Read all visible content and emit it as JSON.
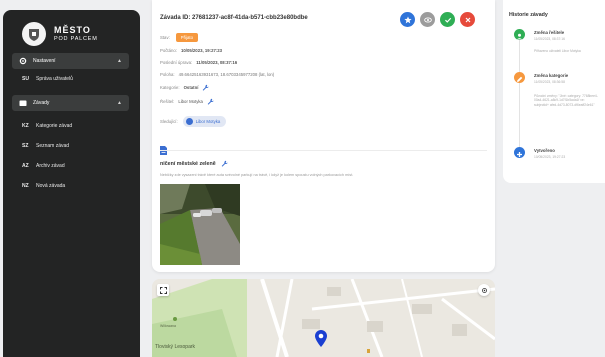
{
  "brand": {
    "line1": "MĚSTO",
    "line2": "POD PALCEM"
  },
  "sidebar": {
    "sections": [
      {
        "label": "Nastavení",
        "items": [
          {
            "code": "SU",
            "label": "Správa uživatelů"
          }
        ]
      },
      {
        "label": "Závady",
        "items": [
          {
            "code": "KZ",
            "label": "Kategorie závad"
          },
          {
            "code": "SZ",
            "label": "Seznam závad"
          },
          {
            "code": "AZ",
            "label": "Archiv závad"
          },
          {
            "code": "NZ",
            "label": "Nová závada"
          }
        ]
      }
    ]
  },
  "defect": {
    "title": "Závada ID: 27681237-ac8f-41da-b571-cbb23e80bdbe",
    "state_label": "Stav:",
    "state_value": "Přijato",
    "reported_label": "Počtáno:",
    "reported_value": "10/05/2023, 19:27:23",
    "last_change_label": "Poslední úprava:",
    "last_change_value": "11/05/2023, 08:37:16",
    "position_label": "Poloha:",
    "position_value": "49.66425163931673, 18.6703345977208 (lat, lon)",
    "category_label": "Kategorie:",
    "category_value": "Ostatní",
    "solver_label": "Řešitel:",
    "solver_value": "Libor Motyka",
    "followers_label": "Sledující:",
    "follower_name": "Libor Motyka",
    "subject": "ničení městské zeleně",
    "description": "Nebičky zde vysazeni trávě které auta svévolné parkují na trávě, i když je kolem spoustu volných parkovacích míst."
  },
  "colors": {
    "sidebar_bg": "#232424",
    "accent_blue": "#2f74d9",
    "state_orange": "#f6983e",
    "delete_red": "#e64a3b",
    "ok_green": "#2fae55",
    "neutral_gray": "#9c9c9c"
  },
  "actions": [
    {
      "name": "star-icon",
      "color": "#2f74d9"
    },
    {
      "name": "eye-icon",
      "color": "#9c9c9c"
    },
    {
      "name": "check-icon",
      "color": "#2fae55"
    },
    {
      "name": "close-icon",
      "color": "#e64a3b"
    }
  ],
  "history": {
    "title": "Historie závady",
    "entries": [
      {
        "title": "Změna řešitele",
        "time": "11/05/2023, 08:37:16",
        "detail": "Přiřazeno uživateli Libor Motyka",
        "color": "#2fae55"
      },
      {
        "title": "Změna kategorie",
        "time": "11/05/2023, 08:36:58",
        "detail": "Původní změny: \"Jiné: category: 7768bee4-00a4-4621-a8c9-1d7f1b5ada1f ve: subjectid+ afed-4d73-8073-df6eaff24e61\"",
        "color": "#f6983e"
      },
      {
        "title": "Vytvořeno",
        "time": "10/05/2023, 19:27:23",
        "detail": "",
        "color": "#2f74d9"
      }
    ]
  },
  "map": {
    "labels": [
      "Tloviský Lesopark",
      "Willowana"
    ]
  }
}
